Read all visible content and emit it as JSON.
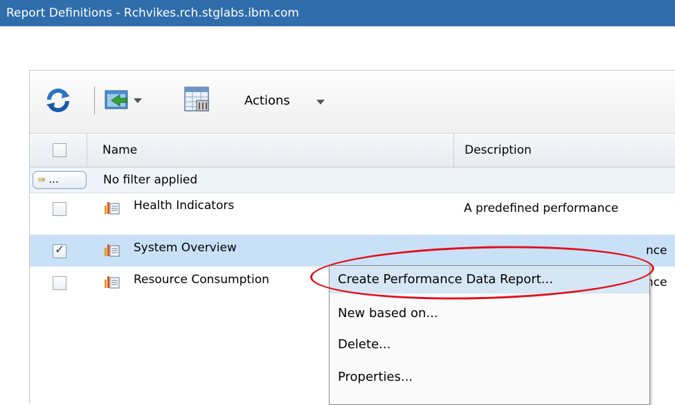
{
  "window": {
    "title": "Report Definitions - Rchvikes.rch.stglabs.ibm.com"
  },
  "toolbar": {
    "refresh_icon": "refresh-icon",
    "export_icon": "export-icon",
    "table_settings_icon": "table-settings-icon",
    "actions_label": "Actions"
  },
  "table": {
    "columns": [
      "Name",
      "Description"
    ],
    "filter_button_label": "...",
    "filter_text": "No filter applied",
    "rows": [
      {
        "name": "Health Indicators",
        "description": "A predefined performance",
        "checked": false
      },
      {
        "name": "System Overview",
        "description": "nce",
        "checked": true
      },
      {
        "name": "Resource Consumption",
        "description": "nce",
        "checked": false
      }
    ]
  },
  "context_menu": {
    "items": [
      "Create Performance Data Report...",
      "New based on...",
      "Delete...",
      "Properties..."
    ]
  },
  "colors": {
    "title_bar": "#2f6dab",
    "selected_row": "#c9e1f7",
    "highlight_oval": "#e0101a"
  }
}
